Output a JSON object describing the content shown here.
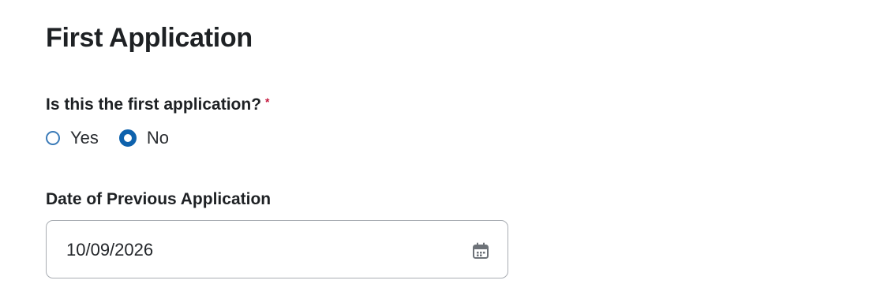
{
  "section": {
    "title": "First Application"
  },
  "first_application_question": {
    "label": "Is this the first application?",
    "required_mark": "*",
    "options": [
      {
        "label": "Yes",
        "checked": false
      },
      {
        "label": "No",
        "checked": true
      }
    ]
  },
  "previous_application_date": {
    "label": "Date of Previous Application",
    "value": "10/09/2026",
    "icon": "calendar-icon"
  },
  "colors": {
    "required": "#c4153b",
    "radio_accent": "#0e62ad",
    "field_border": "#a9adb3"
  }
}
